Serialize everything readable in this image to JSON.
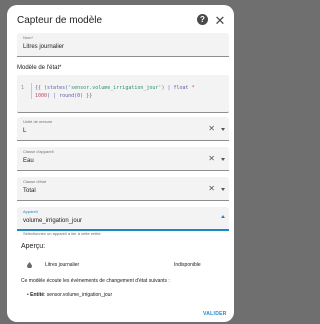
{
  "dialog": {
    "title": "Capteur de modèle",
    "help_glyph": "?",
    "close_glyph": "✕"
  },
  "name_field": {
    "label": "Nom*",
    "value": "Litres journalier"
  },
  "template": {
    "label": "Modèle de l'état*",
    "gutter": "1",
    "line1_a": "{{ (states(",
    "line1_str": "'sensor.volume_irrigation_jour'",
    "line1_b": ") | float ",
    "line1_num": "*",
    "line2_num": "1000",
    "line2_rest": ") | round(0) }}"
  },
  "unit_field": {
    "label": "Unité de mesure",
    "value": "L"
  },
  "device_class_field": {
    "label": "Classe d'appareil",
    "value": "Eau"
  },
  "state_class_field": {
    "label": "Classe d'état",
    "value": "Total"
  },
  "device_field": {
    "label": "Appareil",
    "value": "volume_irrigation_jour"
  },
  "device_helper": "Sélectionnez un appareil à lier à cette entité",
  "preview": {
    "title": "Aperçu:",
    "entity_name": "Litres journalier",
    "entity_state": "Indisponible"
  },
  "listen_text": "Ce modèle écoute les événements de changement d'état suivants :",
  "listen_entity_label": "Entité",
  "listen_entity_value": ": sensor.volume_irrigation_jour",
  "actions": {
    "validate_label": "VALIDER"
  },
  "colors": {
    "accent": "#1e88c7",
    "surface": "#f3f3f3",
    "overlay": "#6f6f6f"
  }
}
